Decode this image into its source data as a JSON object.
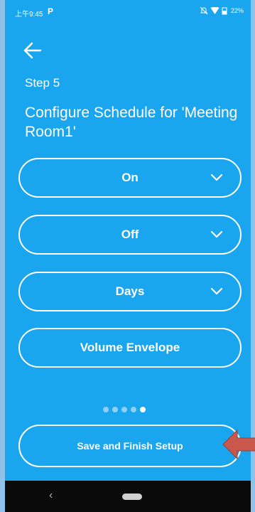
{
  "status_bar": {
    "time": "上午9:45",
    "app_icon": "P",
    "battery": "22%"
  },
  "header": {
    "step": "Step 5",
    "title": "Configure Schedule for 'Meeting Room1'"
  },
  "options": [
    {
      "label": "On",
      "has_dropdown": true
    },
    {
      "label": "Off",
      "has_dropdown": true
    },
    {
      "label": "Days",
      "has_dropdown": true
    },
    {
      "label": "Volume Envelope",
      "has_dropdown": false
    }
  ],
  "pagination": {
    "total": 5,
    "current": 5
  },
  "footer": {
    "save_label": "Save and Finish Setup"
  },
  "nav": {
    "back_glyph": "‹"
  },
  "colors": {
    "background": "#1aa6ee",
    "annotation_arrow": "#c9574b"
  }
}
